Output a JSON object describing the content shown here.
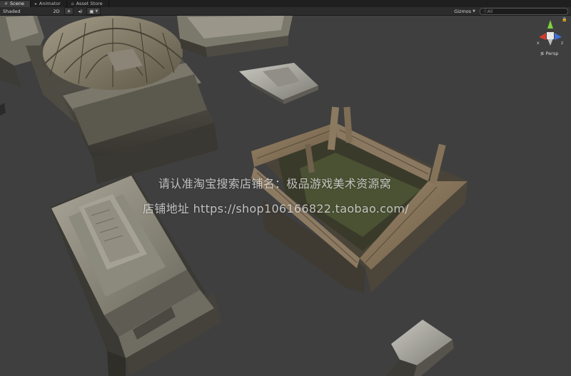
{
  "tabs": [
    {
      "label": "Scene",
      "icon": "scene-icon",
      "active": true
    },
    {
      "label": "Animator",
      "icon": "animator-icon",
      "active": false
    },
    {
      "label": "Asset Store",
      "icon": "store-icon",
      "active": false
    }
  ],
  "toolbar": {
    "shading_mode": "Shaded",
    "mode_2d": "2D",
    "gizmos_label": "Gizmos",
    "search_placeholder": "ⓒAll"
  },
  "gizmo": {
    "axis_x": "x",
    "axis_z": "z",
    "projection": "Persp"
  },
  "watermark": {
    "line1": "请认准淘宝搜索店铺名：极品游戏美术资源窝",
    "line2": "店铺地址 https://shop106166822.taobao.com/"
  },
  "colors": {
    "viewport_bg": "#3f3f3f",
    "axis_x": "#d23b2f",
    "axis_y": "#7fcf3a",
    "axis_z": "#3d6fd8"
  }
}
